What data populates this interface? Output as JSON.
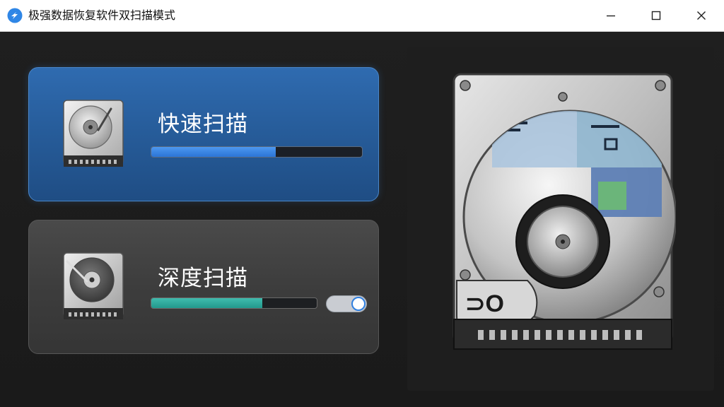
{
  "window": {
    "title": "极强数据恢复软件双扫描模式"
  },
  "titlebar_icons": {
    "app": "app-logo-icon",
    "minimize": "minimize-icon",
    "maximize": "maximize-icon",
    "close": "close-icon"
  },
  "modes": {
    "quick": {
      "label": "快速扫描",
      "progress": 0.59,
      "icon": "hard-drive-icon",
      "color": "#2f6bb0",
      "bar_color": "#2b74d6"
    },
    "deep": {
      "label": "深度扫描",
      "progress": 0.67,
      "icon": "hard-drive-icon",
      "color": "#3d3d3d",
      "bar_color": "#23988c",
      "toggle_on": true
    }
  },
  "illustration": {
    "icon": "hard-disk-drive-illustration"
  }
}
